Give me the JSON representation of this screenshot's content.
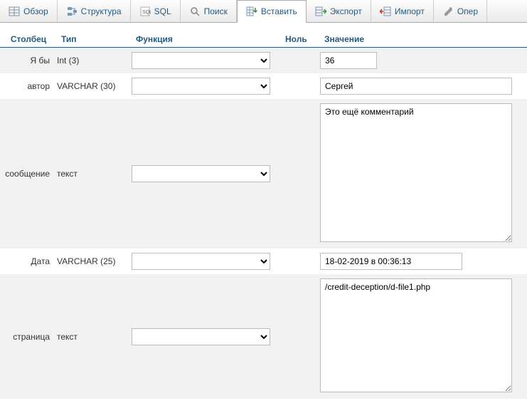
{
  "tabs": {
    "browse": "Обзор",
    "structure": "Структура",
    "sql": "SQL",
    "search": "Поиск",
    "insert": "Вставить",
    "export": "Экспорт",
    "import": "Импорт",
    "operations": "Опер"
  },
  "headers": {
    "column": "Столбец",
    "type": "Тип",
    "function": "Функция",
    "null": "Ноль",
    "value": "Значение"
  },
  "rows": {
    "id": {
      "name": "Я бы",
      "type": "Int (3)",
      "value": "36"
    },
    "author": {
      "name": "автор",
      "type": "VARCHAR (30)",
      "value": "Сергей"
    },
    "message": {
      "name": "сообщение",
      "type": "текст",
      "value": "Это ещё комментарий"
    },
    "date": {
      "name": "Дата",
      "type": "VARCHAR (25)",
      "value": "18-02-2019 в 00:36:13"
    },
    "page": {
      "name": "страница",
      "type": "текст",
      "value": "/credit-deception/d-file1.php"
    }
  }
}
